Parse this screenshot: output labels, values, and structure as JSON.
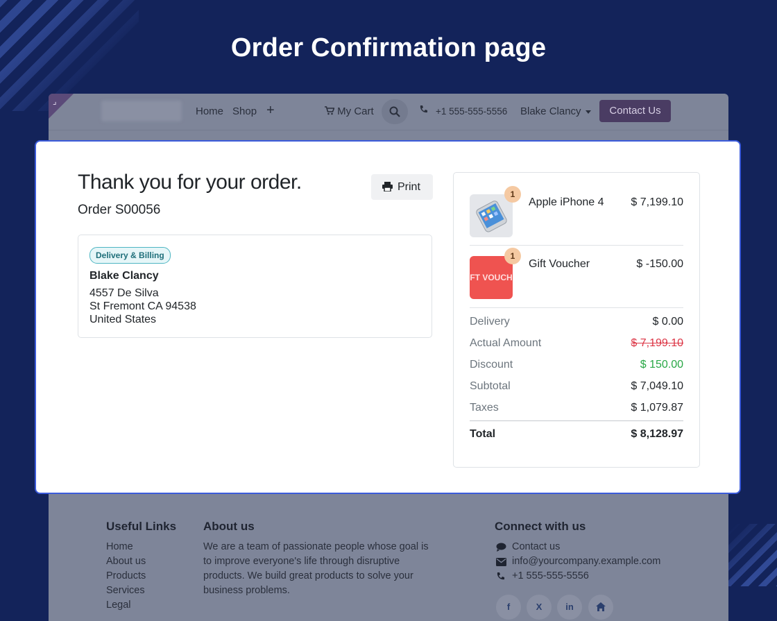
{
  "page_heading": "Order Confirmation page",
  "navbar": {
    "links": [
      "Home",
      "Shop"
    ],
    "cart_label": "My Cart",
    "phone": "+1 555-555-5556",
    "user": "Blake Clancy",
    "contact_button": "Contact Us"
  },
  "confirmation": {
    "title": "Thank you for your order.",
    "order": "Order S00056",
    "print_label": "Print",
    "address_badge": "Delivery & Billing",
    "name": "Blake Clancy",
    "address_lines": [
      "4557 De Silva",
      "St Fremont CA 94538",
      "United States"
    ]
  },
  "items": [
    {
      "name": "Apple iPhone 4",
      "qty": "1",
      "price": "$ 7,199.10",
      "thumb_icon": "phone-image"
    },
    {
      "name": "Gift Voucher",
      "qty": "1",
      "price": "$ -150.00",
      "thumb_icon": "voucher-image",
      "thumb_text": "FT VOUCH"
    }
  ],
  "summary": {
    "delivery_label": "Delivery",
    "delivery": "$ 0.00",
    "actual_label": "Actual Amount",
    "actual": "$ 7,199.10",
    "discount_label": "Discount",
    "discount": "$ 150.00",
    "subtotal_label": "Subtotal",
    "subtotal": "$ 7,049.10",
    "taxes_label": "Taxes",
    "taxes": "$ 1,079.87",
    "total_label": "Total",
    "total": "$ 8,128.97"
  },
  "footer": {
    "useful_links_title": "Useful Links",
    "useful_links": [
      "Home",
      "About us",
      "Products",
      "Services",
      "Legal"
    ],
    "about_title": "About us",
    "about_text": "We are a team of passionate people whose goal is to improve everyone's life through disruptive products. We build great products to solve your business problems.",
    "connect_title": "Connect with us",
    "contact_label": "Contact us",
    "email": "info@yourcompany.example.com",
    "phone": "+1 555-555-5556",
    "social": [
      "f",
      "X",
      "in",
      "home"
    ]
  },
  "colors": {
    "background": "#13235a",
    "card_border": "#3b5bdb",
    "discount": "#28a745",
    "strike": "#dc3545",
    "contact_button": "#4a3c63"
  }
}
